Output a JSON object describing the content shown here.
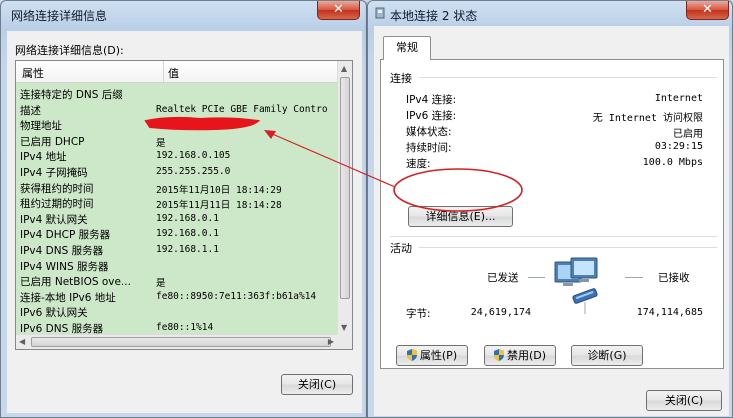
{
  "details_window": {
    "title": "网络连接详细信息",
    "close_glyph": "✕",
    "list_caption": "网络连接详细信息(D):",
    "columns": [
      "属性",
      "值"
    ],
    "rows": [
      {
        "prop": "连接特定的 DNS 后缀",
        "value": ""
      },
      {
        "prop": "描述",
        "value": "Realtek PCIe GBE Family Contro"
      },
      {
        "prop": "物理地址",
        "value": ""
      },
      {
        "prop": "已启用 DHCP",
        "value": "是"
      },
      {
        "prop": "IPv4 地址",
        "value": "192.168.0.105"
      },
      {
        "prop": "IPv4 子网掩码",
        "value": "255.255.255.0"
      },
      {
        "prop": "获得租约的时间",
        "value": "2015年11月10日 18:14:29"
      },
      {
        "prop": "租约过期的时间",
        "value": "2015年11月11日 18:14:28"
      },
      {
        "prop": "IPv4 默认网关",
        "value": "192.168.0.1"
      },
      {
        "prop": "IPv4 DHCP 服务器",
        "value": "192.168.0.1"
      },
      {
        "prop": "IPv4 DNS 服务器",
        "value": "192.168.1.1"
      },
      {
        "prop": "IPv4 WINS 服务器",
        "value": ""
      },
      {
        "prop": "已启用 NetBIOS ove...",
        "value": "是"
      },
      {
        "prop": "连接-本地 IPv6 地址",
        "value": "fe80::8950:7e11:363f:b61a%14"
      },
      {
        "prop": "IPv6 默认网关",
        "value": ""
      },
      {
        "prop": "IPv6 DNS 服务器",
        "value": "fe80::1%14"
      }
    ],
    "close_button": "关闭(C)",
    "redaction_color": "#e8141c"
  },
  "status_window": {
    "title": "本地连接 2 状态",
    "close_glyph": "✕",
    "tab": "常规",
    "connection_group": "连接",
    "connection": [
      {
        "label": "IPv4 连接:",
        "value": "Internet"
      },
      {
        "label": "IPv6 连接:",
        "value": "无 Internet 访问权限"
      },
      {
        "label": "媒体状态:",
        "value": "已启用"
      },
      {
        "label": "持续时间:",
        "value": "03:29:15"
      },
      {
        "label": "速度:",
        "value": "100.0 Mbps"
      }
    ],
    "details_button": "详细信息(E)...",
    "activity_group": "活动",
    "sent_label": "已发送",
    "received_label": "已接收",
    "bytes_label": "字节:",
    "bytes_sent": "24,619,174",
    "bytes_received": "174,114,685",
    "properties_button": "属性(P)",
    "disable_button": "禁用(D)",
    "diagnose_button": "诊断(G)",
    "close_button": "关闭(C)"
  },
  "annotation_color": "#d42020"
}
